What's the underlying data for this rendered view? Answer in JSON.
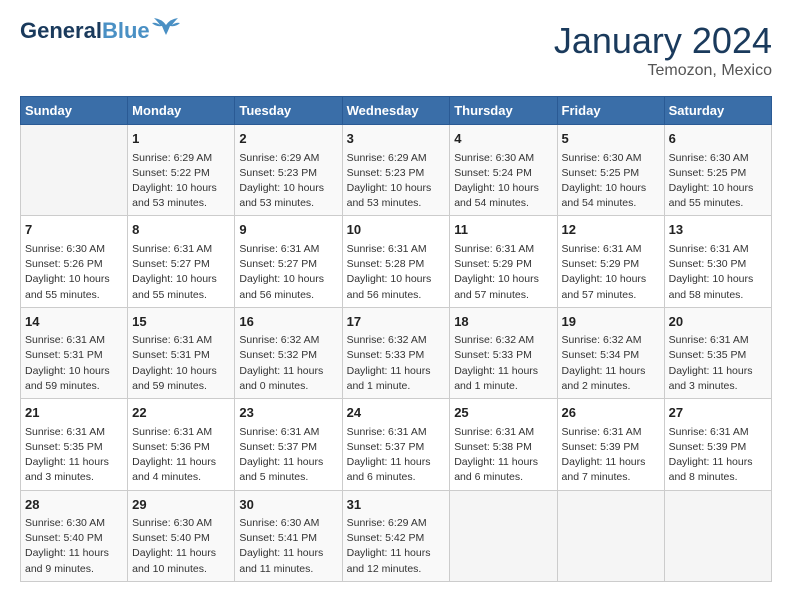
{
  "header": {
    "logo_general": "General",
    "logo_blue": "Blue",
    "month": "January 2024",
    "location": "Temozon, Mexico"
  },
  "days_of_week": [
    "Sunday",
    "Monday",
    "Tuesday",
    "Wednesday",
    "Thursday",
    "Friday",
    "Saturday"
  ],
  "weeks": [
    [
      {
        "day": "",
        "info": ""
      },
      {
        "day": "1",
        "info": "Sunrise: 6:29 AM\nSunset: 5:22 PM\nDaylight: 10 hours\nand 53 minutes."
      },
      {
        "day": "2",
        "info": "Sunrise: 6:29 AM\nSunset: 5:23 PM\nDaylight: 10 hours\nand 53 minutes."
      },
      {
        "day": "3",
        "info": "Sunrise: 6:29 AM\nSunset: 5:23 PM\nDaylight: 10 hours\nand 53 minutes."
      },
      {
        "day": "4",
        "info": "Sunrise: 6:30 AM\nSunset: 5:24 PM\nDaylight: 10 hours\nand 54 minutes."
      },
      {
        "day": "5",
        "info": "Sunrise: 6:30 AM\nSunset: 5:25 PM\nDaylight: 10 hours\nand 54 minutes."
      },
      {
        "day": "6",
        "info": "Sunrise: 6:30 AM\nSunset: 5:25 PM\nDaylight: 10 hours\nand 55 minutes."
      }
    ],
    [
      {
        "day": "7",
        "info": "Sunrise: 6:30 AM\nSunset: 5:26 PM\nDaylight: 10 hours\nand 55 minutes."
      },
      {
        "day": "8",
        "info": "Sunrise: 6:31 AM\nSunset: 5:27 PM\nDaylight: 10 hours\nand 55 minutes."
      },
      {
        "day": "9",
        "info": "Sunrise: 6:31 AM\nSunset: 5:27 PM\nDaylight: 10 hours\nand 56 minutes."
      },
      {
        "day": "10",
        "info": "Sunrise: 6:31 AM\nSunset: 5:28 PM\nDaylight: 10 hours\nand 56 minutes."
      },
      {
        "day": "11",
        "info": "Sunrise: 6:31 AM\nSunset: 5:29 PM\nDaylight: 10 hours\nand 57 minutes."
      },
      {
        "day": "12",
        "info": "Sunrise: 6:31 AM\nSunset: 5:29 PM\nDaylight: 10 hours\nand 57 minutes."
      },
      {
        "day": "13",
        "info": "Sunrise: 6:31 AM\nSunset: 5:30 PM\nDaylight: 10 hours\nand 58 minutes."
      }
    ],
    [
      {
        "day": "14",
        "info": "Sunrise: 6:31 AM\nSunset: 5:31 PM\nDaylight: 10 hours\nand 59 minutes."
      },
      {
        "day": "15",
        "info": "Sunrise: 6:31 AM\nSunset: 5:31 PM\nDaylight: 10 hours\nand 59 minutes."
      },
      {
        "day": "16",
        "info": "Sunrise: 6:32 AM\nSunset: 5:32 PM\nDaylight: 11 hours\nand 0 minutes."
      },
      {
        "day": "17",
        "info": "Sunrise: 6:32 AM\nSunset: 5:33 PM\nDaylight: 11 hours\nand 1 minute."
      },
      {
        "day": "18",
        "info": "Sunrise: 6:32 AM\nSunset: 5:33 PM\nDaylight: 11 hours\nand 1 minute."
      },
      {
        "day": "19",
        "info": "Sunrise: 6:32 AM\nSunset: 5:34 PM\nDaylight: 11 hours\nand 2 minutes."
      },
      {
        "day": "20",
        "info": "Sunrise: 6:31 AM\nSunset: 5:35 PM\nDaylight: 11 hours\nand 3 minutes."
      }
    ],
    [
      {
        "day": "21",
        "info": "Sunrise: 6:31 AM\nSunset: 5:35 PM\nDaylight: 11 hours\nand 3 minutes."
      },
      {
        "day": "22",
        "info": "Sunrise: 6:31 AM\nSunset: 5:36 PM\nDaylight: 11 hours\nand 4 minutes."
      },
      {
        "day": "23",
        "info": "Sunrise: 6:31 AM\nSunset: 5:37 PM\nDaylight: 11 hours\nand 5 minutes."
      },
      {
        "day": "24",
        "info": "Sunrise: 6:31 AM\nSunset: 5:37 PM\nDaylight: 11 hours\nand 6 minutes."
      },
      {
        "day": "25",
        "info": "Sunrise: 6:31 AM\nSunset: 5:38 PM\nDaylight: 11 hours\nand 6 minutes."
      },
      {
        "day": "26",
        "info": "Sunrise: 6:31 AM\nSunset: 5:39 PM\nDaylight: 11 hours\nand 7 minutes."
      },
      {
        "day": "27",
        "info": "Sunrise: 6:31 AM\nSunset: 5:39 PM\nDaylight: 11 hours\nand 8 minutes."
      }
    ],
    [
      {
        "day": "28",
        "info": "Sunrise: 6:30 AM\nSunset: 5:40 PM\nDaylight: 11 hours\nand 9 minutes."
      },
      {
        "day": "29",
        "info": "Sunrise: 6:30 AM\nSunset: 5:40 PM\nDaylight: 11 hours\nand 10 minutes."
      },
      {
        "day": "30",
        "info": "Sunrise: 6:30 AM\nSunset: 5:41 PM\nDaylight: 11 hours\nand 11 minutes."
      },
      {
        "day": "31",
        "info": "Sunrise: 6:29 AM\nSunset: 5:42 PM\nDaylight: 11 hours\nand 12 minutes."
      },
      {
        "day": "",
        "info": ""
      },
      {
        "day": "",
        "info": ""
      },
      {
        "day": "",
        "info": ""
      }
    ]
  ]
}
